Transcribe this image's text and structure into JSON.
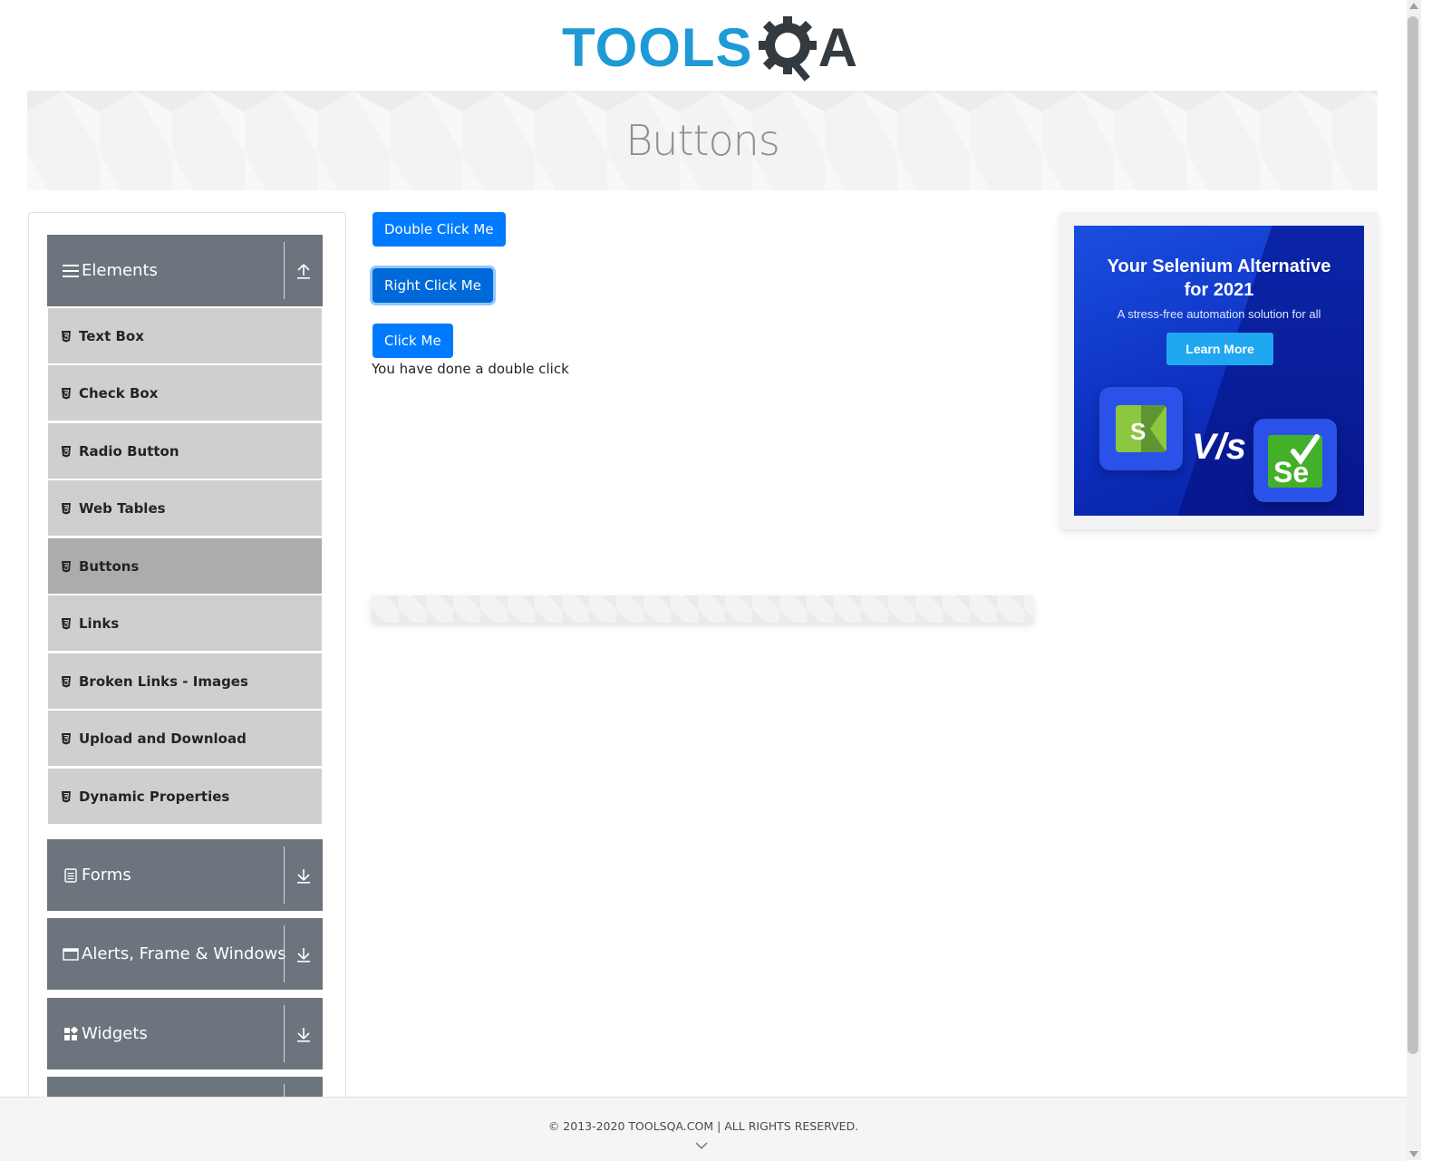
{
  "logo": {
    "part1": "TOOLS",
    "part2": "A"
  },
  "page_title": "Buttons",
  "sidebar": {
    "groups": [
      {
        "title": "Elements",
        "icon": "menu-lines-icon",
        "toggle_icon": "arrow-up-icon"
      },
      {
        "title": "Forms",
        "icon": "document-icon",
        "toggle_icon": "arrow-down-icon"
      },
      {
        "title": "Alerts, Frame & Windows",
        "icon": "window-icon",
        "toggle_icon": "arrow-down-icon"
      },
      {
        "title": "Widgets",
        "icon": "widgets-icon",
        "toggle_icon": "arrow-down-icon"
      }
    ],
    "elements_items": [
      {
        "label": "Text Box"
      },
      {
        "label": "Check Box"
      },
      {
        "label": "Radio Button"
      },
      {
        "label": "Web Tables"
      },
      {
        "label": "Buttons",
        "active": true
      },
      {
        "label": "Links"
      },
      {
        "label": "Broken Links - Images"
      },
      {
        "label": "Upload and Download"
      },
      {
        "label": "Dynamic Properties"
      }
    ]
  },
  "main": {
    "double_click_label": "Double Click Me",
    "right_click_label": "Right Click Me",
    "click_label": "Click Me",
    "message": "You have done a double click"
  },
  "ad": {
    "title_line1": "Your Selenium Alternative",
    "title_line2": "for 2021",
    "subtitle": "A stress-free automation solution for all",
    "button": "Learn More",
    "vs": "V/s",
    "logo_left": "S",
    "logo_right": "Se"
  },
  "footer": {
    "text": "© 2013-2020 TOOLSQA.COM | ALL RIGHTS RESERVED."
  },
  "colors": {
    "primary": "#007bff",
    "sidebar_header": "#6c757d",
    "menu_item": "#cfcfcf",
    "menu_item_active": "#acacac",
    "logo_blue": "#1e9ad6"
  }
}
